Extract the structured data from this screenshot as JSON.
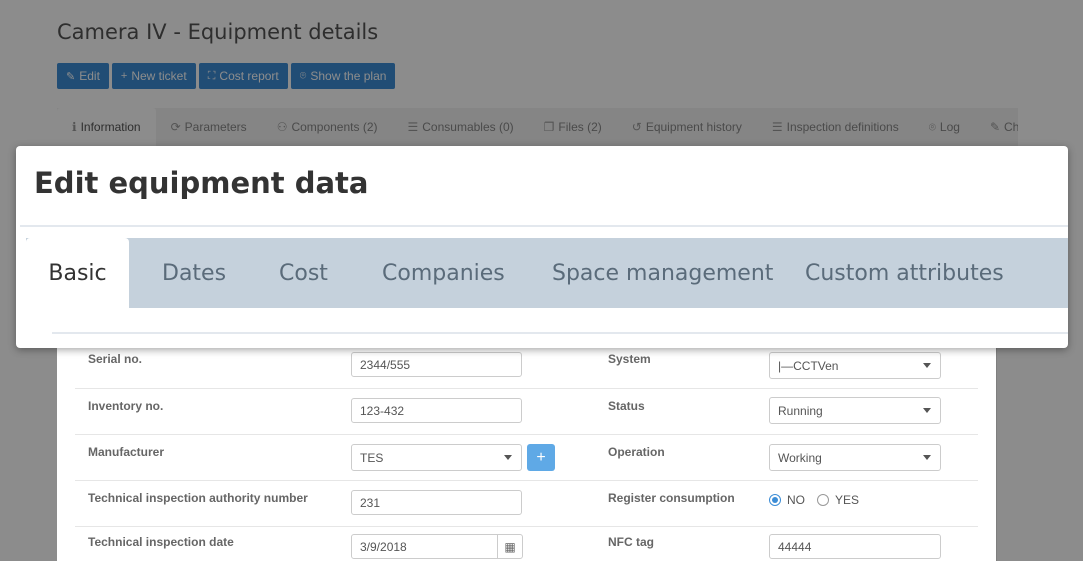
{
  "page": {
    "title": "Camera IV - Equipment details"
  },
  "toolbar": {
    "buttons": [
      {
        "icon": "pencil-icon",
        "glyph": "✎",
        "label": "Edit"
      },
      {
        "icon": "plus-icon",
        "glyph": "+",
        "label": "New ticket"
      },
      {
        "icon": "chart-icon",
        "glyph": "⛶",
        "label": "Cost report"
      },
      {
        "icon": "map-pin-icon",
        "glyph": "⌾",
        "label": "Show the plan"
      }
    ]
  },
  "detail_tabs": [
    {
      "icon": "info-icon",
      "glyph": "ℹ",
      "label": "Information"
    },
    {
      "icon": "refresh-icon",
      "glyph": "⟳",
      "label": "Parameters"
    },
    {
      "icon": "users-icon",
      "glyph": "⚇",
      "label": "Components (2)"
    },
    {
      "icon": "list-icon",
      "glyph": "☰",
      "label": "Consumables (0)"
    },
    {
      "icon": "files-icon",
      "glyph": "❐",
      "label": "Files (2)"
    },
    {
      "icon": "history-icon",
      "glyph": "↺",
      "label": "Equipment history"
    },
    {
      "icon": "list-icon",
      "glyph": "☰",
      "label": "Inspection definitions"
    },
    {
      "icon": "map-pin-icon",
      "glyph": "⌾",
      "label": "Log"
    },
    {
      "icon": "edit-icon",
      "glyph": "✎",
      "label": "Cha"
    }
  ],
  "modal": {
    "title": "Edit equipment data",
    "tabs": [
      "Basic",
      "Dates",
      "Cost",
      "Companies",
      "Space management",
      "Custom attributes"
    ],
    "active_tab": "Basic"
  },
  "form": {
    "serial_no": {
      "label": "Serial no.",
      "value": "2344/555"
    },
    "system": {
      "label": "System",
      "value": "|—CCTVen"
    },
    "inventory_no": {
      "label": "Inventory no.",
      "value": "123-432"
    },
    "status": {
      "label": "Status",
      "value": "Running"
    },
    "manufacturer": {
      "label": "Manufacturer",
      "value": "TES",
      "add_label": "+"
    },
    "operation": {
      "label": "Operation",
      "value": "Working"
    },
    "tech_authority": {
      "label": "Technical inspection authority number",
      "value": "231"
    },
    "register_consumption": {
      "label": "Register consumption",
      "options": [
        "NO",
        "YES"
      ],
      "selected": "NO"
    },
    "tech_date": {
      "label": "Technical inspection date",
      "value": "3/9/2018"
    },
    "nfc_tag": {
      "label": "NFC tag",
      "value": "44444"
    }
  },
  "colors": {
    "primary": "#3c8dd6",
    "tab_strip": "#c5d1dc"
  }
}
